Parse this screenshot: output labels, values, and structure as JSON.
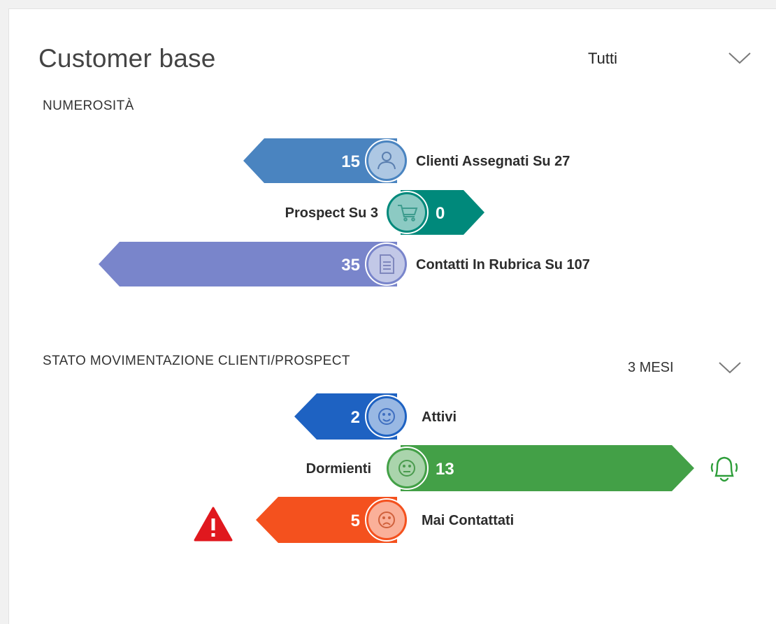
{
  "header": {
    "title": "Customer base",
    "filter_value": "Tutti"
  },
  "numerosita": {
    "section_label": "NUMEROSITÀ",
    "rows": [
      {
        "value": "15",
        "label": "Clienti Assegnati Su 27",
        "icon": "user-icon",
        "color": "#4a84c0"
      },
      {
        "value": "0",
        "label": "Prospect Su 3",
        "icon": "cart-icon",
        "color": "#00897b"
      },
      {
        "value": "35",
        "label": "Contatti In Rubrica Su 107",
        "icon": "document-icon",
        "color": "#7985cb"
      }
    ]
  },
  "movimentazione": {
    "section_label": "STATO MOVIMENTAZIONE CLIENTI/PROSPECT",
    "period_value": "3 MESI",
    "rows": [
      {
        "value": "2",
        "label": "Attivi",
        "icon": "smile-icon",
        "color": "#1e62c2"
      },
      {
        "value": "13",
        "label": "Dormienti",
        "icon": "neutral-face-icon",
        "color": "#43a047",
        "alert_icon": "bell-ringing-icon",
        "alert_color": "#2e9e3a"
      },
      {
        "value": "5",
        "label": "Mai Contattati",
        "icon": "sad-face-icon",
        "color": "#f4511e",
        "alert_icon": "warning-icon",
        "alert_color": "#e0181e"
      }
    ]
  }
}
